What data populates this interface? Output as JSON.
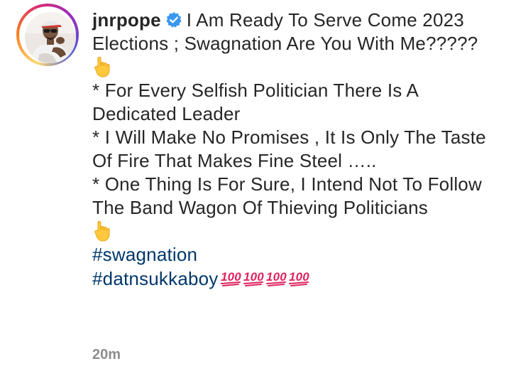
{
  "post": {
    "username": "jnrpope",
    "caption_first": "I Am Ready To Serve Come 2023 Elections ; Swagnation Are You With Me?????",
    "lines": [
      "*  For Every Selfish Politician There Is A Dedicated Leader",
      "* I Will Make No Promises , It Is Only The Taste Of Fire That Makes Fine Steel …..",
      "* One Thing Is For Sure, I Intend Not To Follow The Band Wagon Of Thieving Politicians"
    ],
    "hashtags": [
      "#swagnation",
      "#datnsukkaboy"
    ],
    "timestamp": "20m"
  },
  "icons": {
    "verified": "verified-badge-icon",
    "pointing": "pointing-down-hand-icon",
    "hundred": "hundred-points-icon"
  },
  "colors": {
    "text": "#262626",
    "hashtag": "#00376b",
    "timestamp": "#8e8e8e",
    "verified": "#3897f0",
    "hundred": "#e0245e"
  }
}
